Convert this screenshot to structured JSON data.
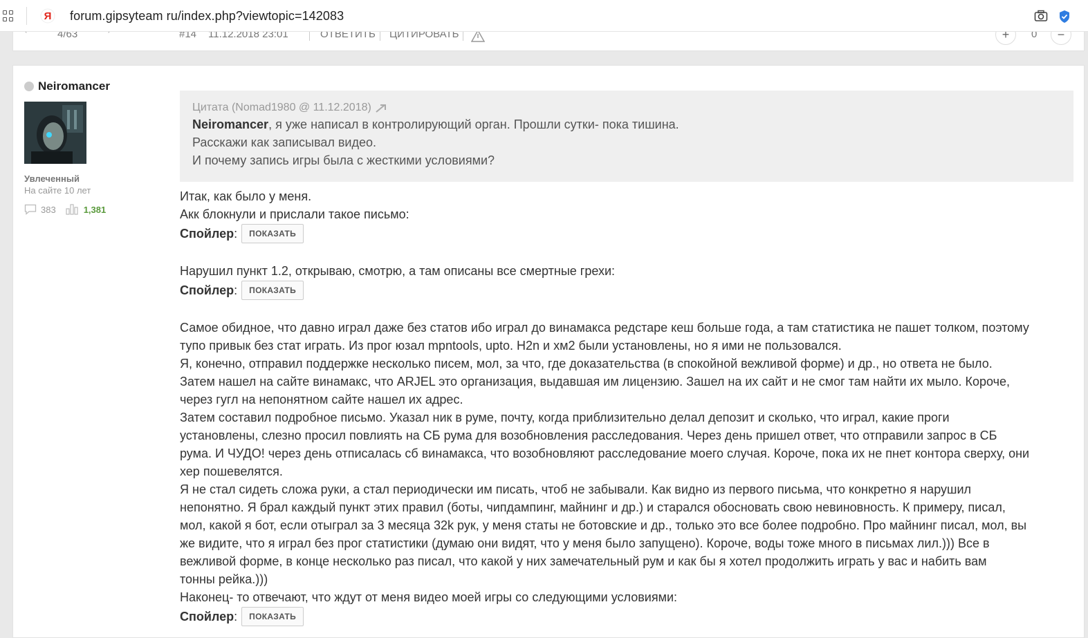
{
  "browser": {
    "url": "forum.gipsyteam ru/index.php?viewtopic=142083"
  },
  "topic_nav": {
    "back_arrow": "←",
    "page": "4/63",
    "forward_arrow": "→",
    "post_number": "#14",
    "post_date": "11.12.2018 23:01",
    "reply": "ОТВЕТИТЬ",
    "quote": "ЦИТИРОВАТЬ",
    "plus": "+",
    "rating": "0",
    "minus": "−"
  },
  "author": {
    "name": "Neiromancer",
    "rank": "Увлеченный",
    "since": "На сайте 10 лет",
    "posts": "383",
    "likes": "1,381"
  },
  "quote": {
    "header": "Цитата (Nomad1980 @ 11.12.2018)",
    "mention": "Neiromancer",
    "line1_rest": ", я уже написал в контролирующий орган. Прошли сутки- пока тишина.",
    "line2": "Расскажи как записывал видео.",
    "line3": "И почему запись игры была с жесткими условиями?"
  },
  "spoiler": {
    "label": "Спойлер",
    "colon": ":",
    "button": "ПОКАЗАТЬ"
  },
  "body": {
    "p1": "Итак, как было у меня.",
    "p2": "Акк блокнули и прислали такое письмо:",
    "p3": "Нарушил пункт 1.2, открываю, смотрю, а там описаны все смертные грехи:",
    "p4": [
      "Самое обидное, что давно играл даже без статов ибо играл до винамакса редстаре кеш больше года, а там статистика не пашет толком, поэтому",
      "тупо привык без стат играть. Из прог юзал mpntools, upto. H2n и хм2 были установлены, но я ими не пользовался.",
      "Я, конечно, отправил поддержке несколько писем, мол, за что, где доказательства (в спокойной вежливой форме) и др., но ответа не было.",
      "Затем нашел на сайте винамакс, что ARJEL это организация, выдавшая им лицензию. Зашел на их сайт и не смог там найти их мыло. Короче,",
      "через гугл на непонятном сайте нашел их адрес.",
      "Затем составил подробное письмо. Указал ник в руме, почту, когда приблизительно делал депозит и сколько, что играл, какие проги",
      "установлены, слезно просил повлиять на СБ рума для возобновления расследования. Через день пришел ответ, что отправили запрос в СБ",
      "рума. И ЧУДО! через день отписалась сб винамакса, что возобновляют расследование моего случая. Короче, пока их не пнет контора сверху, они",
      "хер пошевелятся.",
      "Я не стал сидеть сложа руки, а стал периодически им писать, чтоб не забывали. Как видно из первого письма, что конкретно я нарушил",
      "непонятно. Я брал каждый пункт этих правил (боты, чипдампинг, майнинг и др.) и старался обосновать свою невиновность. К примеру, писал,",
      "мол, какой я бот, если отыграл за 3 месяца 32k рук, у меня статы не ботовские и др., только это все более подробно. Про майнинг писал, мол, вы",
      "же видите, что я играл без прог статистики (думаю они видят, что у меня было запущено). Короче, воды тоже много в письмах лил.))) Все в",
      "вежливой форме, в конце несколько раз писал, что какой у них замечательный рум и как бы я хотел продолжить играть у вас и набить вам",
      "тонны рейка.)))",
      "Наконец- то отвечают, что ждут от меня видео моей игры со следующими условиями:"
    ]
  }
}
